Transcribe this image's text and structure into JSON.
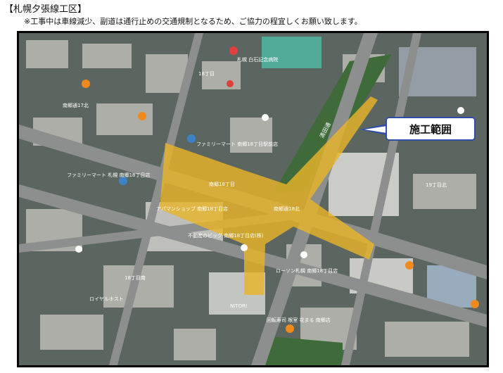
{
  "header": {
    "title": "【札幌夕張線工区】",
    "notice": "※工事中は車線減少、副道は通行止めの交通規制となるため、ご協力の程宜しくお願い致します。"
  },
  "callout": {
    "label": "施工範囲"
  },
  "colors": {
    "construction_zone": "#e8b32a",
    "callout_border": "#2d4fa8",
    "road": "#8d8f8e",
    "park": "#3f6b3a"
  },
  "map_labels": {
    "street_kiyota": "清田通",
    "place_minami18_top": "18丁目",
    "place_minami18_left": "南郷18丁目",
    "place_minami17": "南郷通17北",
    "place_minami18_right": "南郷通18北",
    "place_19": "19丁目北",
    "place_18_lower": "18丁目南",
    "family_mart_1": "ファミリーマート 南郷18丁目駅前店",
    "family_mart_2": "ファミリーマート 札幌 南郷18丁目店",
    "yamaguchi": "アパマンショップ 南郷18丁目店",
    "fudosan": "不動産のビッグ 南郷18丁目店(株)",
    "lawson": "ローソン札幌 南郷18丁目店",
    "sushi": "回転寿司 根室 花まる 南郷店",
    "royal": "ロイヤルホスト",
    "nitori": "NITORI",
    "hospital": "札幌 白石記念病院"
  }
}
